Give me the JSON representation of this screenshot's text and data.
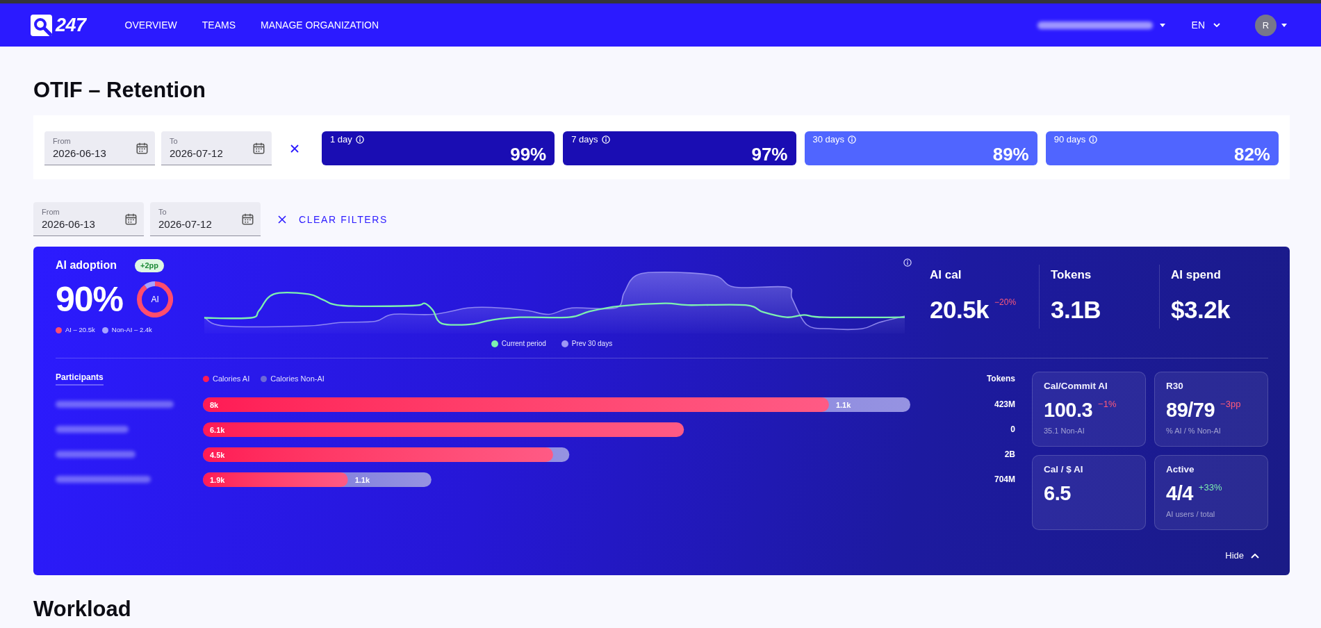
{
  "header": {
    "logo_text": "247",
    "nav": [
      {
        "label": "OVERVIEW"
      },
      {
        "label": "TEAMS"
      },
      {
        "label": "MANAGE ORGANIZATION"
      }
    ],
    "language": "EN",
    "avatar_initial": "R"
  },
  "page_title": "OTIF – Retention",
  "period_filter": {
    "date_from": {
      "label": "From",
      "value": "2026-06-13"
    },
    "date_to": {
      "label": "To",
      "value": "2026-07-12"
    },
    "periods": [
      {
        "label": "1 day",
        "value": "99%",
        "color": "#1a0db3"
      },
      {
        "label": "7 days",
        "value": "97%",
        "color": "#1a0db3"
      },
      {
        "label": "30 days",
        "value": "89%",
        "color": "#5065ff"
      },
      {
        "label": "90 days",
        "value": "82%",
        "color": "#5065ff"
      }
    ]
  },
  "filters": {
    "date_from": {
      "label": "From",
      "value": "2026-06-13"
    },
    "date_to": {
      "label": "To",
      "value": "2026-07-12"
    },
    "clear_label": "CLEAR FILTERS"
  },
  "ai_panel": {
    "adoption": {
      "title": "AI adoption",
      "badge": "+2pp",
      "value": "90%",
      "donut_label": "AI",
      "level": 0.9,
      "legend": [
        {
          "label": "AI – 20.5k",
          "color": "#ff4d6d"
        },
        {
          "label": "Non-AI – 2.4k",
          "color": "#a7a3ff"
        }
      ]
    },
    "trend_legend": [
      {
        "label": "Current period",
        "color": "#7ef0b0"
      },
      {
        "label": "Prev 30 days",
        "color": "#9d97f5"
      }
    ],
    "stats": [
      {
        "title": "AI cal",
        "value": "20.5k",
        "delta": {
          "text": "−20%",
          "color": "#ff5a7a"
        }
      },
      {
        "title": "Tokens",
        "value": "3.1B"
      },
      {
        "title": "AI spend",
        "value": "$3.2k"
      }
    ],
    "participants": {
      "title": "Participants",
      "legend": [
        {
          "label": "Calories AI",
          "color": "#ff1a55"
        },
        {
          "label": "Calories Non-AI",
          "color": "#6d69d6"
        }
      ],
      "tokens_title": "Tokens",
      "rows": [
        {
          "ai": {
            "label": "8k",
            "level": 0.885
          },
          "non_ai": {
            "label": "1.1k"
          },
          "total": {
            "level": 1.0
          },
          "tokens": "423M"
        },
        {
          "ai": {
            "label": "6.1k",
            "level": 0.68
          },
          "tokens": "0"
        },
        {
          "ai": {
            "label": "4.5k",
            "level": 0.495
          },
          "total": {
            "level": 0.518
          },
          "tokens": "2B"
        },
        {
          "ai": {
            "label": "1.9k",
            "level": 0.205
          },
          "non_ai": {
            "label": "1.1k"
          },
          "total": {
            "level": 0.323
          },
          "tokens": "704M"
        }
      ]
    },
    "metrics": [
      {
        "title": "Cal/Commit AI",
        "value": "100.3",
        "delta": {
          "text": "−1%",
          "color": "#ff5a7a"
        },
        "caption": "35.1 Non-AI"
      },
      {
        "title": "R30",
        "value": "89/79",
        "delta": {
          "text": "−3pp",
          "color": "#ff5a7a"
        },
        "caption": "% AI / % Non-AI"
      },
      {
        "title": "Cal / $ AI",
        "value": "6.5"
      },
      {
        "title": "Active",
        "value": "4/4",
        "delta": {
          "text": "+33%",
          "color": "#7ef0b0"
        },
        "caption": "AI users / total"
      }
    ],
    "hide_label": "Hide"
  },
  "next_section_title": "Workload"
}
